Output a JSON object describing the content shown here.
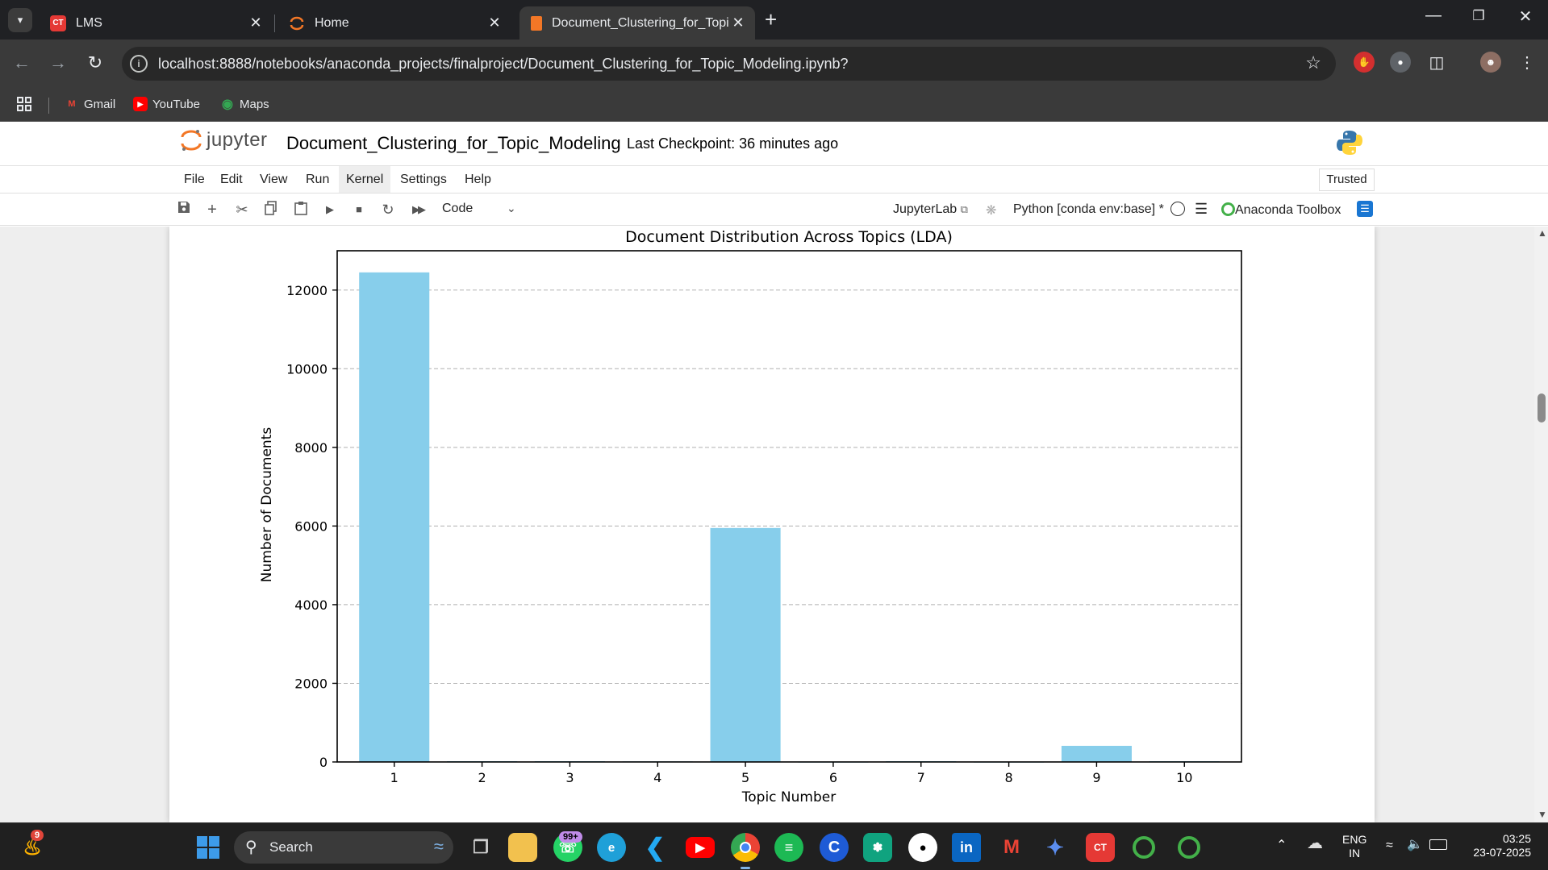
{
  "browser": {
    "tabs": [
      {
        "title": "LMS",
        "favicon": "CT"
      },
      {
        "title": "Home",
        "favicon": "jupyter"
      },
      {
        "title": "Document_Clustering_for_Topic",
        "favicon": "notebook"
      }
    ],
    "url": "localhost:8888/notebooks/anaconda_projects/finalproject/Document_Clustering_for_Topic_Modeling.ipynb?",
    "bookmarks": [
      "Gmail",
      "YouTube",
      "Maps"
    ]
  },
  "jupyter": {
    "logo_text": "jupyter",
    "notebook_title": "Document_Clustering_for_Topic_Modeling",
    "checkpoint": "Last Checkpoint: 36 minutes ago",
    "menu": [
      "File",
      "Edit",
      "View",
      "Run",
      "Kernel",
      "Settings",
      "Help"
    ],
    "trusted": "Trusted",
    "cell_type": "Code",
    "jupyterlab_link": "JupyterLab",
    "kernel": "Python [conda env:base] *",
    "anaconda_toolbox": "Anaconda Toolbox"
  },
  "chart_data": {
    "type": "bar",
    "title": "Document Distribution Across Topics (LDA)",
    "xlabel": "Topic Number",
    "ylabel": "Number of Documents",
    "categories": [
      "1",
      "2",
      "3",
      "4",
      "5",
      "6",
      "7",
      "8",
      "9",
      "10"
    ],
    "values": [
      12450,
      20,
      20,
      15,
      5950,
      5,
      20,
      5,
      410,
      20
    ],
    "ylim": [
      0,
      13000
    ],
    "yticks": [
      0,
      2000,
      4000,
      6000,
      8000,
      10000,
      12000
    ],
    "grid": "horizontal dashed",
    "bar_color": "#87CEEB"
  },
  "taskbar": {
    "search_label": "Search",
    "notification_count": "9",
    "whatsapp_badge": "99+",
    "lang": "ENG",
    "region": "IN",
    "time": "03:25",
    "date": "23-07-2025"
  }
}
